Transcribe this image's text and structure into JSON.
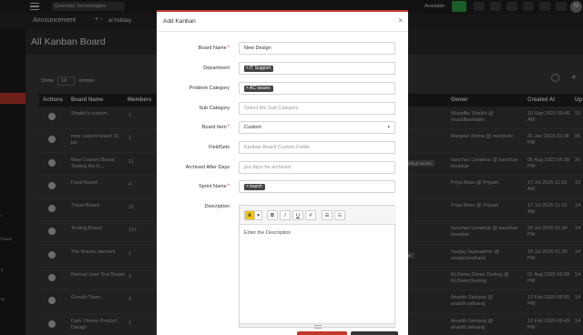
{
  "topbar": {
    "company": "Greentec Technologies",
    "availability": "Available",
    "avatar_initials": "M"
  },
  "subbar": {
    "announcement": "Announcement",
    "plus": "+ -",
    "holiday": "al holiday"
  },
  "sidebar": {
    "labels": [
      "r",
      "board",
      "s",
      "at"
    ]
  },
  "page": {
    "title": "All Kanban Board",
    "show_label": "Show",
    "show_value": "10",
    "entries_label": "entries"
  },
  "table": {
    "headers": [
      "Actions",
      "Board Name",
      "Members",
      "Owner",
      "Created At",
      "Up"
    ],
    "rows": [
      {
        "name": "Shaikh's custom",
        "members": "1",
        "owner": "Muzaffar Shaikh @ muzaffarshaikh",
        "created": "10 Sep 2023 09:46 AM",
        "updated": "10",
        "tag": ""
      },
      {
        "name": "new custom board 31 jan",
        "members": "1",
        "owner": "Manjeet Verma @ manjeetv",
        "created": "31 Jan 2018 01:08 PM",
        "updated": "06",
        "tag": ""
      },
      {
        "name": "New Custom Board Testing the K...",
        "members": "11",
        "owner": "kanchan Lonarkar @ kanchan lonarkar",
        "created": "05 Aug 2023 06:38 PM",
        "updated": "26",
        "tag": "Github Issues"
      },
      {
        "name": "Food Board",
        "members": "4",
        "owner": "Priya Maru @ Priyam",
        "created": "17 Jul 2025 11:16 AM",
        "updated": "13",
        "tag": ""
      },
      {
        "name": "Ticket Board",
        "members": "22",
        "owner": "Priya Maru @ Priyam",
        "created": "17 Jul 2025 11:19 AM",
        "updated": "14",
        "tag": ""
      },
      {
        "name": "Testing Board",
        "members": "117",
        "owner": "kanchan Lonarkar @ kanchan lonarkar",
        "created": "28 Jul 2025 01:34 PM",
        "updated": "14",
        "tag": ""
      },
      {
        "name": "The Brame element",
        "members": "1",
        "owner": "Sanjay Supeadmin @ sanjay.knotrank",
        "created": "29 Jul 2025 01:39 PM",
        "updated": "14",
        "tag": "Ne"
      },
      {
        "name": "Normal User Test Board",
        "members": "3",
        "owner": "KLDemo Demo Testing @ KLDemoTesting",
        "created": "01 Aug 2025 05:08 PM",
        "updated": "14",
        "tag": ""
      },
      {
        "name": "Growth Team",
        "members": "3",
        "owner": "Ananth Selvaraj @ ananth.selvaraj",
        "created": "13 Feb 2026 06:55 PM",
        "updated": "14",
        "tag": ""
      },
      {
        "name": "Dark Theme Product Design",
        "members": "1",
        "owner": "Ananth Selvaraj @ ananth.selvaraj",
        "created": "13 Feb 2026 06:49 PM",
        "updated": "14",
        "tag": ""
      }
    ]
  },
  "modal": {
    "title": "Add Kanban",
    "close": "×",
    "fields": {
      "board_name": {
        "label": "Board Name",
        "value": "New Design"
      },
      "department": {
        "label": "Department",
        "chip": "IT Support"
      },
      "problem_category": {
        "label": "Problem Category",
        "chip": "AC Issues"
      },
      "sub_category": {
        "label": "Sub Category",
        "placeholder": "Select the Sub Category"
      },
      "board_item": {
        "label": "Board Item",
        "value": "Custom"
      },
      "fieldsets": {
        "label": "FieldSets",
        "placeholder": "Kanban Board Custom Fields"
      },
      "archived_after_days": {
        "label": "Archived After Days",
        "placeholder": "put days for archived"
      },
      "sprint_name": {
        "label": "Sprint Name",
        "chip": "march"
      },
      "description": {
        "label": "Description",
        "placeholder": "Enter the Description"
      }
    },
    "toolbar": {
      "font_color": "A",
      "dropdown": "▾",
      "bold": "B",
      "italic": "I",
      "underline": "U",
      "clear": "✐",
      "ul": "☰",
      "ol": "☷"
    }
  },
  "colors": {
    "accent": "#c0392b",
    "chip": "#444444",
    "highlight": "#f1c40f"
  }
}
